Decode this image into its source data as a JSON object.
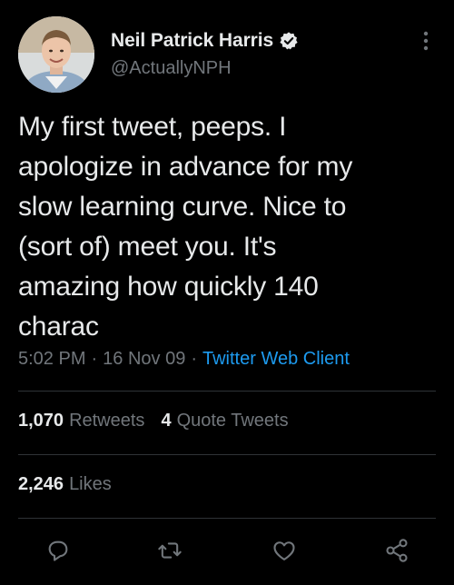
{
  "user": {
    "display_name": "Neil Patrick Harris",
    "handle": "@ActuallyNPH",
    "verified": true
  },
  "tweet": {
    "text": "My first tweet, peeps.  I\napologize in advance for my\nslow learning curve.  Nice to\n(sort of) meet you.  It's\namazing how quickly 140\ncharac",
    "time": "5:02 PM",
    "date": "16 Nov 09",
    "separator": "·",
    "client": "Twitter Web Client"
  },
  "stats": {
    "retweets_count": "1,070",
    "retweets_label": "Retweets",
    "quote_count": "4",
    "quote_label": "Quote Tweets",
    "likes_count": "2,246",
    "likes_label": "Likes"
  },
  "icons": {
    "more": "more-dots-icon",
    "verified": "verified-badge-icon",
    "reply": "reply-icon",
    "retweet": "retweet-icon",
    "like": "heart-icon",
    "share": "share-icon"
  },
  "colors": {
    "background": "#000000",
    "text": "#e7e9ea",
    "muted": "#71767b",
    "accent": "#1d9bf0",
    "divider": "#2f3336"
  }
}
